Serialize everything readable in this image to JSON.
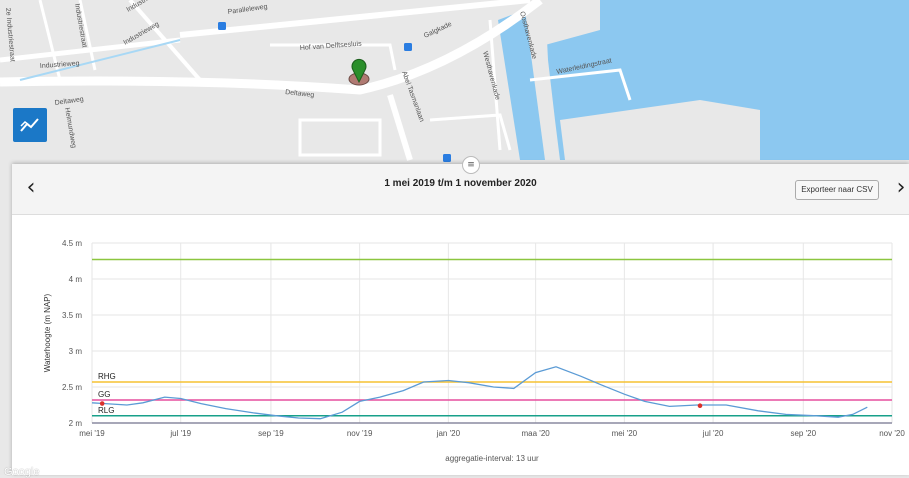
{
  "map": {
    "streets": [
      "Paralleleweg",
      "Galgkade",
      "Hof van Delftsesluis",
      "Deltaweg",
      "Deltaweg",
      "Industrieweg",
      "Industrieweg",
      "Abel Tasmanlaan",
      "Westhavenkade",
      "Oosthavenkade",
      "Waterleidingstraat",
      "2e Industriestraat",
      "Industriestraat",
      "Helmundweg",
      "Industrieweg"
    ],
    "google_label": "Google",
    "marker_icon": "location-pin-icon",
    "layer_button_icon": "chart-line-icon"
  },
  "panel": {
    "handle_glyph": "≡",
    "prev_glyph": "‹",
    "next_glyph": "›",
    "title": "1 mei 2019 t/m 1 november 2020",
    "export_label": "Exporteer naar CSV",
    "footer": "aggregatie-interval: 13 uur"
  },
  "chart_data": {
    "type": "line",
    "ylabel": "Waterhoogte (m NAP)",
    "ylim": [
      2,
      4.5
    ],
    "yticks": [
      "2 m",
      "2.5 m",
      "3 m",
      "3.5 m",
      "4 m",
      "4.5 m"
    ],
    "xticks": [
      "mei '19",
      "jul '19",
      "sep '19",
      "nov '19",
      "jan '20",
      "maa '20",
      "mei '20",
      "jul '20",
      "sep '20",
      "nov '20"
    ],
    "x_range": [
      "2019-05-01",
      "2020-11-01"
    ],
    "grid": true,
    "reference_lines": [
      {
        "label": "",
        "value": 4.27,
        "color": "#8cc63f"
      },
      {
        "label": "RHG",
        "value": 2.57,
        "color": "#f5c232"
      },
      {
        "label": "GG",
        "value": 2.32,
        "color": "#e64f9e"
      },
      {
        "label": "RLG",
        "value": 2.1,
        "color": "#17a08a"
      }
    ],
    "baseline_color": "#8a8aa0",
    "series": [
      {
        "color": "#5b9bd5",
        "points": [
          [
            "2019-05-01",
            2.28
          ],
          [
            "2019-05-10",
            2.27
          ],
          [
            "2019-05-25",
            2.25
          ],
          [
            "2019-06-05",
            2.28
          ],
          [
            "2019-06-20",
            2.36
          ],
          [
            "2019-07-01",
            2.34
          ],
          [
            "2019-07-15",
            2.27
          ],
          [
            "2019-08-01",
            2.2
          ],
          [
            "2019-08-20",
            2.14
          ],
          [
            "2019-09-05",
            2.1
          ],
          [
            "2019-09-20",
            2.07
          ],
          [
            "2019-10-05",
            2.06
          ],
          [
            "2019-10-20",
            2.15
          ],
          [
            "2019-11-01",
            2.3
          ],
          [
            "2019-11-15",
            2.36
          ],
          [
            "2019-12-01",
            2.45
          ],
          [
            "2019-12-15",
            2.57
          ],
          [
            "2020-01-01",
            2.59
          ],
          [
            "2020-01-15",
            2.56
          ],
          [
            "2020-02-01",
            2.5
          ],
          [
            "2020-02-15",
            2.48
          ],
          [
            "2020-03-01",
            2.7
          ],
          [
            "2020-03-15",
            2.78
          ],
          [
            "2020-04-01",
            2.65
          ],
          [
            "2020-04-15",
            2.53
          ],
          [
            "2020-05-01",
            2.4
          ],
          [
            "2020-05-15",
            2.3
          ],
          [
            "2020-06-01",
            2.23
          ],
          [
            "2020-06-20",
            2.25
          ],
          [
            "2020-07-10",
            2.25
          ],
          [
            "2020-08-01",
            2.17
          ],
          [
            "2020-08-20",
            2.12
          ],
          [
            "2020-09-10",
            2.1
          ],
          [
            "2020-09-25",
            2.08
          ],
          [
            "2020-10-05",
            2.12
          ],
          [
            "2020-10-15",
            2.22
          ]
        ]
      }
    ],
    "markers": [
      {
        "x": "2019-05-08",
        "y": 2.27,
        "color": "#d9302c"
      },
      {
        "x": "2020-06-22",
        "y": 2.24,
        "color": "#d9302c"
      }
    ]
  }
}
